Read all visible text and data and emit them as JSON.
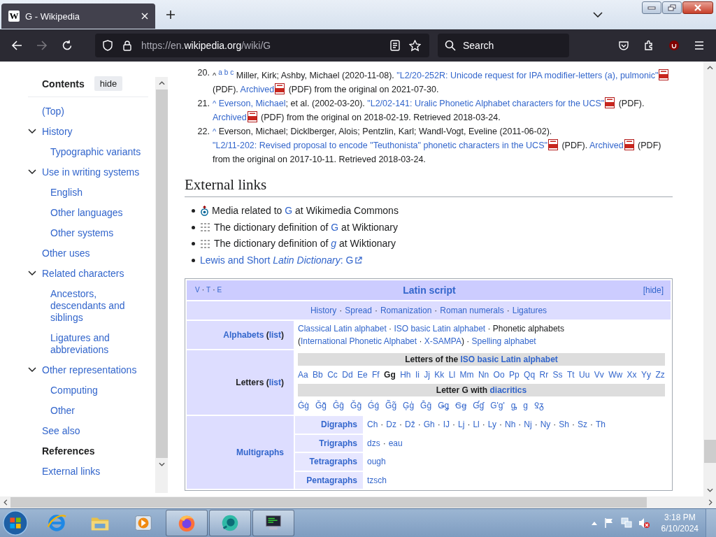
{
  "browser": {
    "tab": {
      "favicon": "W",
      "title": "G - Wikipedia",
      "selected": true
    },
    "url": {
      "prefix": "https://en.",
      "domain": "wikipedia.org",
      "path": "/wiki/G"
    },
    "search": {
      "placeholder": "Search"
    }
  },
  "toc": {
    "title": "Contents",
    "hide": "hide",
    "items": [
      {
        "label": "(Top)",
        "selected": false
      },
      {
        "label": "History",
        "selected": false,
        "expanded": true,
        "children": [
          {
            "label": "Typographic variants",
            "selected": false
          }
        ]
      },
      {
        "label": "Use in writing systems",
        "selected": false,
        "expanded": true,
        "children": [
          {
            "label": "English",
            "selected": false
          },
          {
            "label": "Other languages",
            "selected": false
          },
          {
            "label": "Other systems",
            "selected": false
          }
        ]
      },
      {
        "label": "Other uses",
        "selected": false
      },
      {
        "label": "Related characters",
        "selected": false,
        "expanded": true,
        "children": [
          {
            "label": "Ancestors, descendants and siblings",
            "selected": false
          },
          {
            "label": "Ligatures and abbreviations",
            "selected": false
          }
        ]
      },
      {
        "label": "Other representations",
        "selected": false,
        "expanded": true,
        "children": [
          {
            "label": "Computing",
            "selected": false
          },
          {
            "label": "Other",
            "selected": false
          }
        ]
      },
      {
        "label": "See also",
        "selected": false
      },
      {
        "label": "References",
        "selected": true
      },
      {
        "label": "External links",
        "selected": false
      }
    ]
  },
  "references": [
    {
      "number": "20.",
      "caret": "^",
      "backlinks": [
        "a",
        "b",
        "c"
      ],
      "segments": [
        {
          "kind": "text",
          "text": "Miller, Kirk; Ashby, Michael (2020-11-08). "
        },
        {
          "kind": "pdf_link",
          "text": "\"L2/20-252R: Unicode request for IPA modifier-letters (a), pulmonic\""
        },
        {
          "kind": "text",
          "text": " (PDF). "
        },
        {
          "kind": "pdf_link",
          "text": "Archived"
        },
        {
          "kind": "text",
          "text": " (PDF) from the original on 2021-07-30."
        }
      ]
    },
    {
      "number": "21.",
      "caret": "^",
      "segments": [
        {
          "kind": "link",
          "text": "Everson, Michael"
        },
        {
          "kind": "text",
          "text": "; et al. (2002-03-20). "
        },
        {
          "kind": "pdf_link",
          "text": "\"L2/02-141: Uralic Phonetic Alphabet characters for the UCS\""
        },
        {
          "kind": "text",
          "text": " (PDF). "
        },
        {
          "kind": "pdf_link",
          "text": "Archived"
        },
        {
          "kind": "text",
          "text": " (PDF) from the original on 2018-02-19. Retrieved 2018-03-24."
        }
      ]
    },
    {
      "number": "22.",
      "caret": "^",
      "segments": [
        {
          "kind": "text",
          "text": "Everson, Michael; Dicklberger, Alois; Pentzlin, Karl; Wandl-Vogt, Eveline (2011-06-02). "
        },
        {
          "kind": "pdf_link",
          "text": "\"L2/11-202: Revised proposal to encode \"Teuthonista\" phonetic characters in the UCS\""
        },
        {
          "kind": "text",
          "text": " (PDF). "
        },
        {
          "kind": "pdf_link",
          "text": "Archived"
        },
        {
          "kind": "text",
          "text": " (PDF) from the original on 2017-10-11. Retrieved 2018-03-24."
        }
      ]
    }
  ],
  "external_links": {
    "heading": "External links",
    "items": [
      {
        "kind": "commons",
        "segments": [
          {
            "kind": "text",
            "text": "Media related to "
          },
          {
            "kind": "link",
            "text": "G"
          },
          {
            "kind": "text",
            "text": " at Wikimedia Commons"
          }
        ]
      },
      {
        "kind": "wiktionary",
        "segments": [
          {
            "kind": "text",
            "text": "The dictionary definition of "
          },
          {
            "kind": "link",
            "text": "G"
          },
          {
            "kind": "text",
            "text": " at Wiktionary"
          }
        ]
      },
      {
        "kind": "wiktionary",
        "segments": [
          {
            "kind": "text",
            "text": "The dictionary definition of "
          },
          {
            "kind": "link",
            "text": "*g*"
          },
          {
            "kind": "text",
            "text": " at Wiktionary"
          }
        ]
      },
      {
        "kind": "plain",
        "segments": [
          {
            "kind": "external_link",
            "text": "Lewis and Short *Latin Dictionary*: G"
          }
        ]
      }
    ]
  },
  "navbox": {
    "vte": [
      "V",
      "T",
      "E"
    ],
    "title": "Latin script",
    "hide": "[hide]",
    "separator": "·",
    "links": [
      "History",
      "Spread",
      "Romanization",
      "Roman numerals",
      "Ligatures"
    ],
    "groups": [
      {
        "kind": "list",
        "label": [
          {
            "kind": "link",
            "text": "Alphabets"
          },
          {
            "kind": "text",
            "text": " ("
          },
          {
            "kind": "link",
            "text": "list"
          },
          {
            "kind": "text",
            "text": ")"
          }
        ],
        "segments": [
          {
            "kind": "link",
            "text": "Classical Latin alphabet"
          },
          {
            "kind": "text",
            "text": " · "
          },
          {
            "kind": "link",
            "text": "ISO basic Latin alphabet"
          },
          {
            "kind": "text",
            "text": " · Phonetic alphabets ("
          },
          {
            "kind": "link",
            "text": "International Phonetic Alphabet"
          },
          {
            "kind": "text",
            "text": " · "
          },
          {
            "kind": "link",
            "text": "X-SAMPA"
          },
          {
            "kind": "text",
            "text": ") · "
          },
          {
            "kind": "link",
            "text": "Spelling alphabet"
          }
        ]
      },
      {
        "kind": "letters",
        "label": [
          {
            "kind": "text",
            "text": "Letters ("
          },
          {
            "kind": "link",
            "text": "list"
          },
          {
            "kind": "text",
            "text": ")"
          }
        ],
        "sections": [
          {
            "heading": [
              {
                "kind": "text",
                "text": "Letters of the "
              },
              {
                "kind": "link",
                "text": "ISO basic Latin alphabet"
              }
            ],
            "items": [
              {
                "text": "Aa",
                "selected": false
              },
              {
                "text": "Bb",
                "selected": false
              },
              {
                "text": "Cc",
                "selected": false
              },
              {
                "text": "Dd",
                "selected": false
              },
              {
                "text": "Ee",
                "selected": false
              },
              {
                "text": "Ff",
                "selected": false
              },
              {
                "text": "Gg",
                "selected": true
              },
              {
                "text": "Hh",
                "selected": false
              },
              {
                "text": "Ii",
                "selected": false
              },
              {
                "text": "Jj",
                "selected": false
              },
              {
                "text": "Kk",
                "selected": false
              },
              {
                "text": "Ll",
                "selected": false
              },
              {
                "text": "Mm",
                "selected": false
              },
              {
                "text": "Nn",
                "selected": false
              },
              {
                "text": "Oo",
                "selected": false
              },
              {
                "text": "Pp",
                "selected": false
              },
              {
                "text": "Qq",
                "selected": false
              },
              {
                "text": "Rr",
                "selected": false
              },
              {
                "text": "Ss",
                "selected": false
              },
              {
                "text": "Tt",
                "selected": false
              },
              {
                "text": "Uu",
                "selected": false
              },
              {
                "text": "Vv",
                "selected": false
              },
              {
                "text": "Ww",
                "selected": false
              },
              {
                "text": "Xx",
                "selected": false
              },
              {
                "text": "Yy",
                "selected": false
              },
              {
                "text": "Zz",
                "selected": false
              }
            ]
          },
          {
            "heading": [
              {
                "kind": "text",
                "text": "Letter G with "
              },
              {
                "kind": "link",
                "text": "diacritics"
              }
            ],
            "items": [
              {
                "text": "Ġġ",
                "selected": false
              },
              {
                "text": "Ğğ",
                "selected": false
              },
              {
                "text": "Ĝĝ",
                "selected": false
              },
              {
                "text": "Ǧǧ",
                "selected": false
              },
              {
                "text": "Ǵǵ",
                "selected": false
              },
              {
                "text": "G̃g̃",
                "selected": false
              },
              {
                "text": "Ģģ",
                "selected": false
              },
              {
                "text": "Ḡḡ",
                "selected": false
              },
              {
                "text": "Ǥǥ",
                "selected": false
              },
              {
                "text": "Ꞡꞡ",
                "selected": false
              },
              {
                "text": "Ɠɠ",
                "selected": false
              },
              {
                "text": "G'g'",
                "selected": false
              },
              {
                "text": "ᶃ",
                "selected": false
              },
              {
                "text": "ɡ",
                "selected": false
              },
              {
                "text": "Ꝿᵹ",
                "selected": false
              }
            ]
          }
        ]
      },
      {
        "kind": "subgroups",
        "label": [
          {
            "kind": "link",
            "text": "Multigraphs"
          }
        ],
        "rows": [
          {
            "label": "Digraphs",
            "items": [
              "Ch",
              "Dz",
              "Dž",
              "Gh",
              "IJ",
              "Lj",
              "Ll",
              "Ly",
              "Nh",
              "Nj",
              "Ny",
              "Sh",
              "Sz",
              "Th"
            ]
          },
          {
            "label": "Trigraphs",
            "items": [
              "dzs",
              "eau"
            ]
          },
          {
            "label": "Tetragraphs",
            "items": [
              "ough"
            ]
          },
          {
            "label": "Pentagraphs",
            "items": [
              "tzsch"
            ]
          }
        ]
      }
    ]
  },
  "taskbar": {
    "apps": [
      {
        "kind": "ie",
        "running": false
      },
      {
        "kind": "explorer",
        "running": false
      },
      {
        "kind": "media",
        "running": false
      },
      {
        "kind": "firefox",
        "running": true
      },
      {
        "kind": "chat",
        "running": true
      },
      {
        "kind": "terminal",
        "running": true
      }
    ],
    "time": "3:18 PM",
    "date": "6/10/2024"
  }
}
